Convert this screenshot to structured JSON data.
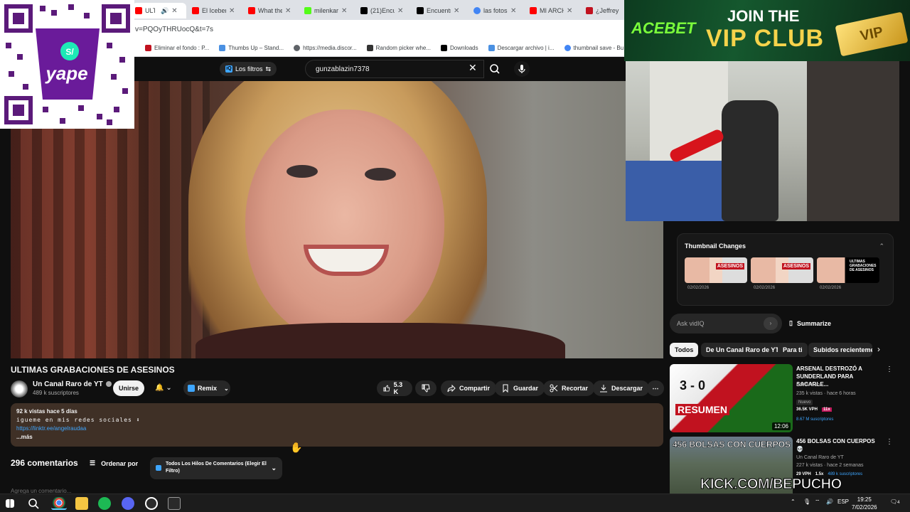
{
  "browser": {
    "tabs": [
      {
        "label": "ULTI",
        "color": "#ff0000",
        "active": true
      },
      {
        "label": "El Iceber",
        "color": "#ff0000"
      },
      {
        "label": "What the",
        "color": "#ff0000"
      },
      {
        "label": "milenkar",
        "color": "#53fc18"
      },
      {
        "label": "(21)Encu",
        "color": "#000000"
      },
      {
        "label": "Encuentr",
        "color": "#000000"
      },
      {
        "label": "las fotos",
        "color": "#4285f4"
      },
      {
        "label": "MI ARCH",
        "color": "#ff0000"
      },
      {
        "label": "¿Jeffrey",
        "color": "#c1121f"
      }
    ],
    "address": "v=PQOyTHRUocQ&t=7s",
    "bookmarks": [
      {
        "label": "Eliminar el fondo : P...",
        "color": "#c1121f"
      },
      {
        "label": "Thumbs Up – Stand...",
        "color": "#4a90e2"
      },
      {
        "label": "https://media.discor...",
        "color": "#5f6368"
      },
      {
        "label": "Random picker whe...",
        "color": "#333333"
      },
      {
        "label": "Downloads",
        "color": "#000000"
      },
      {
        "label": "Descargar archivo | i...",
        "color": "#4a90e2"
      },
      {
        "label": "thumbnail save - Bu...",
        "color": "#4285f4"
      }
    ]
  },
  "masthead": {
    "filters_label": "Los filtros",
    "search_value": "gunzablazin7378"
  },
  "video": {
    "title": "ULTIMAS GRABACIONES DE ASESINOS",
    "channel": "Un Canal Raro de YT",
    "subscribers": "489 k suscriptores",
    "join_label": "Unirse",
    "remix_label": "Remix",
    "likes": "5.3 K",
    "share_label": "Compartir",
    "save_label": "Guardar",
    "clip_label": "Recortar",
    "download_label": "Descargar",
    "more_label": "⋯"
  },
  "description": {
    "meta": "92 k vistas  hace 5 días",
    "line": "igueme en mis redes sociales ⬇",
    "link": "https://linktr.ee/angelraudaa",
    "more": "...más"
  },
  "comments": {
    "count": "296 comentarios",
    "sort_label": "Ordenar por",
    "filter_label": "Todos Los Hilos De Comentarios (Elegir El Filtro)",
    "add_placeholder": "Agrega un comentario..."
  },
  "thumbnail_changes": {
    "title": "Thumbnail Changes",
    "items": [
      {
        "caption": "ASESINOS",
        "date": "02/02/2026"
      },
      {
        "caption": "ASESINOS",
        "date": "02/02/2026"
      },
      {
        "caption": "ULTIMAS GRABACIONES DE ASESINOS",
        "date": "02/02/2026"
      }
    ]
  },
  "ask": {
    "placeholder": "Ask vidIQ",
    "summarize_label": "Summarize"
  },
  "chips": [
    "Todos",
    "De Un Canal Raro de YT",
    "Para ti",
    "Subidos recientemente"
  ],
  "recommendations": [
    {
      "title": "ARSENAL DESTROZÓ A SUNDERLAND PARA SACARLE...",
      "channel": "ESPN Fans",
      "stats": "235 k vistas · hace 6 horas",
      "badge": "Nuevo",
      "vph": "36.5K VPH",
      "multiplier": "11x",
      "subs": "8.67 M suscriptores",
      "duration": "12:06",
      "thumb_text": "RESUMEN",
      "score": "3 - 0"
    },
    {
      "title": "456 BOLSAS CON CUERPOS 💀",
      "channel": "Un Canal Raro de YT",
      "stats": "227 k vistas · hace 2 semanas",
      "vph": "29 VPH",
      "multiplier": "1.5x",
      "subs": "489 k suscriptores",
      "thumb_text": "456 BOLSAS CON CUERPOS"
    }
  ],
  "overlays": {
    "qr_brand": "yape",
    "banner_brand": "ACEBET",
    "banner_line1": "JOIN THE",
    "banner_line2": "VIP CLUB",
    "banner_card": "VIP",
    "kick_text": "KICK.COM/BEPUCHO"
  },
  "taskbar": {
    "language": "ESP",
    "time": "19:25",
    "date": "7/02/2026",
    "notifications": "4"
  }
}
